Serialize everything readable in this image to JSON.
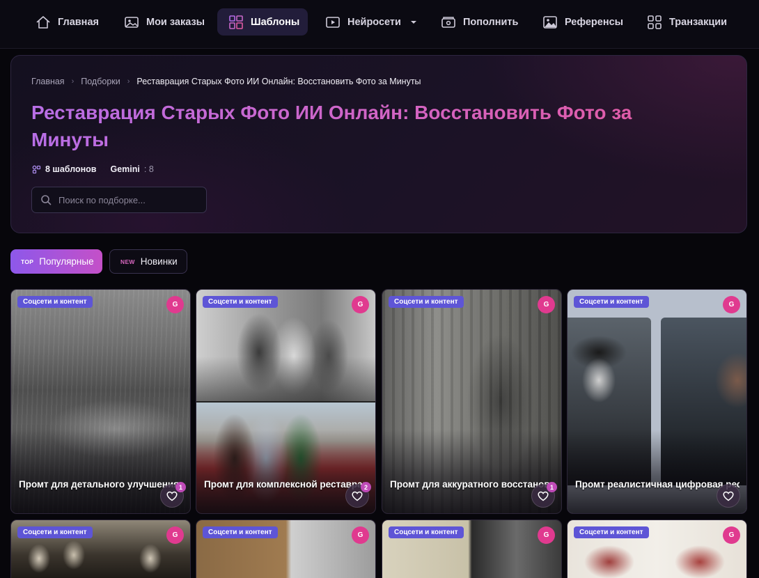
{
  "nav": {
    "items": [
      {
        "label": "Главная",
        "icon": "home-icon"
      },
      {
        "label": "Мои заказы",
        "icon": "image-icon"
      },
      {
        "label": "Шаблоны",
        "icon": "templates-grid-icon",
        "active": true
      },
      {
        "label": "Нейросети",
        "icon": "play-icon",
        "dropdown": true
      },
      {
        "label": "Пополнить",
        "icon": "wallet-icon"
      },
      {
        "label": "Референсы",
        "icon": "picture-icon"
      },
      {
        "label": "Транзакции",
        "icon": "grid-icon"
      }
    ]
  },
  "breadcrumb": {
    "items": [
      "Главная",
      "Подборки"
    ],
    "current": "Реставрация Старых Фото ИИ Онлайн: Восстановить Фото за Минуты"
  },
  "page": {
    "title": "Реставрация Старых Фото ИИ Онлайн: Восстановить Фото за Минуты",
    "templates_count": "8 шаблонов",
    "model_name": "Gemini",
    "model_count": ": 8"
  },
  "search": {
    "value": "",
    "placeholder": "Поиск по подборке..."
  },
  "filters": {
    "popular": {
      "tag": "TOP",
      "label": "Популярные",
      "active": true
    },
    "new": {
      "tag": "NEW",
      "label": "Новинки"
    }
  },
  "cards": [
    {
      "category": "Соцсети и контент",
      "model": "G",
      "title": "Промт для детального улучшения старого портрета без изменений",
      "likes": "1"
    },
    {
      "category": "Соцсети и контент",
      "model": "G",
      "title": "Промт для комплексной реставрации и колоризации...",
      "likes": "2"
    },
    {
      "category": "Соцсети и контент",
      "model": "G",
      "title": "Промт для аккуратного восстановления старого фото",
      "likes": "1"
    },
    {
      "category": "Соцсети и контент",
      "model": "G",
      "title": "Промт реалистичная цифровая реставрация старых фотографий",
      "likes": ""
    },
    {
      "category": "Соцсети и контент",
      "model": "G"
    },
    {
      "category": "Соцсети и контент",
      "model": "G"
    },
    {
      "category": "Соцсети и контент",
      "model": "G"
    },
    {
      "category": "Соцсети и контент",
      "model": "G"
    }
  ],
  "colors": {
    "accent_purple": "#8d58ea",
    "accent_pink": "#e03a8f",
    "category_badge": "#5e55d6",
    "background": "#07060b"
  }
}
